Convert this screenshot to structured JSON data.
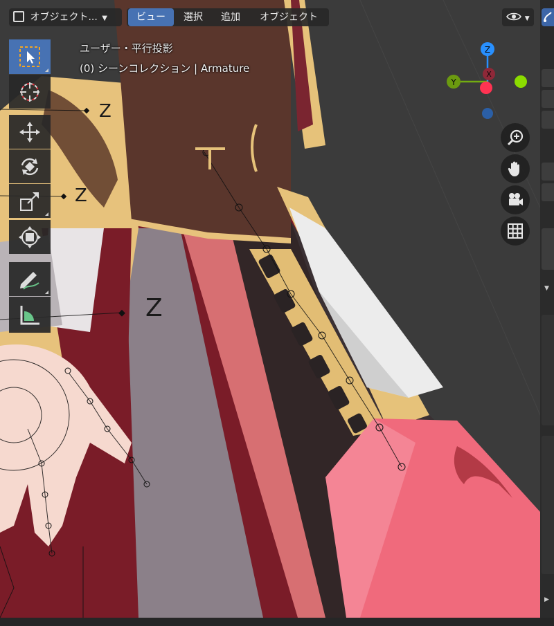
{
  "header": {
    "mode_dropdown": "オブジェクト...",
    "menus": [
      "ビュー",
      "選択",
      "追加",
      "オブジェクト"
    ]
  },
  "viewport_info": {
    "view_name": "ユーザー・平行投影",
    "collection": "(0) シーンコレクション | Armature"
  },
  "gizmo": {
    "z_label": "Z",
    "y_label": "Y",
    "x_label": "X",
    "colors": {
      "x": "#ff3352",
      "y": "#8bdc00",
      "z": "#2890ff"
    }
  },
  "bone_labels": [
    "Z",
    "Z",
    "Z"
  ],
  "tools": [
    {
      "name": "select-box",
      "icon": "select-box-icon"
    },
    {
      "name": "cursor",
      "icon": "cursor-icon"
    },
    {
      "name": "move",
      "icon": "move-icon"
    },
    {
      "name": "rotate",
      "icon": "rotate-icon"
    },
    {
      "name": "scale",
      "icon": "scale-icon"
    },
    {
      "name": "transform",
      "icon": "transform-icon"
    },
    {
      "name": "annotate",
      "icon": "annotate-icon"
    },
    {
      "name": "measure",
      "icon": "measure-icon"
    }
  ],
  "navigation": [
    "zoom-icon",
    "pan-hand-icon",
    "camera-icon",
    "grid-icon"
  ],
  "accent": "#4772b3"
}
